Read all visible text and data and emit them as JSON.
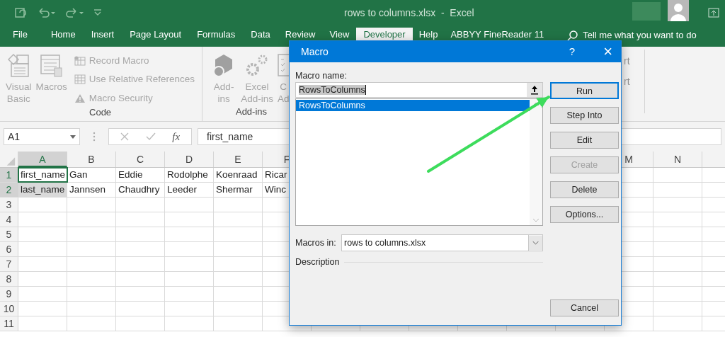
{
  "window": {
    "title": "rows to columns.xlsx  -  Excel"
  },
  "menu_tabs": [
    {
      "label": "File",
      "selected": false
    },
    {
      "label": "Home",
      "selected": false
    },
    {
      "label": "Insert",
      "selected": false
    },
    {
      "label": "Page Layout",
      "selected": false
    },
    {
      "label": "Formulas",
      "selected": false
    },
    {
      "label": "Data",
      "selected": false
    },
    {
      "label": "Review",
      "selected": false
    },
    {
      "label": "View",
      "selected": false
    },
    {
      "label": "Developer",
      "selected": true
    },
    {
      "label": "Help",
      "selected": false
    },
    {
      "label": "ABBYY FineReader 11",
      "selected": false
    }
  ],
  "tell_me": {
    "placeholder": "Tell me what you want to do"
  },
  "ribbon": {
    "groups": [
      {
        "label": "Code",
        "large_buttons": [
          {
            "kind": "visual-basic",
            "lines": [
              "Visual",
              "Basic"
            ]
          },
          {
            "kind": "macros",
            "lines": [
              "Macros"
            ]
          }
        ],
        "small_buttons": [
          {
            "kind": "record",
            "label": "Record Macro"
          },
          {
            "kind": "relative",
            "label": "Use Relative References"
          },
          {
            "kind": "security",
            "label": "Macro Security"
          }
        ]
      },
      {
        "label": "Add-ins",
        "large_buttons": [
          {
            "kind": "addins",
            "lines": [
              "Add-",
              "ins"
            ]
          },
          {
            "kind": "excel-addins",
            "lines": [
              "Excel",
              "Add-ins"
            ]
          },
          {
            "kind": "com-addins",
            "lines": [
              "C",
              "Ad"
            ]
          }
        ]
      }
    ],
    "disabled": true,
    "right_fragments": [
      "rt",
      "rt"
    ]
  },
  "name_box": {
    "value": "A1"
  },
  "formula_bar": {
    "fx": "fx",
    "value": "first_name"
  },
  "sheet": {
    "columns": [
      {
        "label": "A",
        "selected": true
      },
      {
        "label": "B",
        "selected": false
      },
      {
        "label": "C",
        "selected": false
      },
      {
        "label": "D",
        "selected": false
      },
      {
        "label": "E",
        "selected": false
      },
      {
        "label": "F",
        "selected": false
      },
      {
        "label": "M",
        "selected": false
      },
      {
        "label": "N",
        "selected": false
      }
    ],
    "rows": [
      {
        "number": "1",
        "selected": true,
        "cells": [
          {
            "text": "first_name",
            "selected": true,
            "active": true
          },
          {
            "text": "Gan"
          },
          {
            "text": "Eddie"
          },
          {
            "text": "Rodolphe"
          },
          {
            "text": "Koenraad"
          },
          {
            "text": "Ricar"
          }
        ]
      },
      {
        "number": "2",
        "selected": true,
        "cells": [
          {
            "text": "last_name",
            "selected": true,
            "active": false
          },
          {
            "text": "Jannsen"
          },
          {
            "text": "Chaudhry"
          },
          {
            "text": "Leeder"
          },
          {
            "text": "Shermar"
          },
          {
            "text": "Winc"
          }
        ]
      },
      {
        "number": "3",
        "selected": false
      },
      {
        "number": "4",
        "selected": false
      },
      {
        "number": "5",
        "selected": false
      },
      {
        "number": "6",
        "selected": false
      },
      {
        "number": "7",
        "selected": false
      },
      {
        "number": "8",
        "selected": false
      },
      {
        "number": "9",
        "selected": false
      },
      {
        "number": "10",
        "selected": false
      },
      {
        "number": "11",
        "selected": false
      }
    ]
  },
  "dialog": {
    "title": "Macro",
    "help": "?",
    "close": "×",
    "macro_name_label": "Macro name:",
    "macro_name": "RowsToColumns",
    "macros": [
      {
        "name": "RowsToColumns",
        "selected": true
      }
    ],
    "macros_in_label": "Macros in:",
    "macros_in": "rows to columns.xlsx",
    "description_label": "Description",
    "buttons": [
      {
        "label": "Run",
        "disabled": false,
        "focused": true
      },
      {
        "label": "Step Into",
        "disabled": false,
        "focused": false
      },
      {
        "label": "Edit",
        "disabled": false,
        "focused": false
      },
      {
        "label": "Create",
        "disabled": true,
        "focused": false
      },
      {
        "label": "Delete",
        "disabled": false,
        "focused": false
      },
      {
        "label": "Options...",
        "disabled": false,
        "focused": false
      }
    ],
    "cancel": "Cancel"
  }
}
